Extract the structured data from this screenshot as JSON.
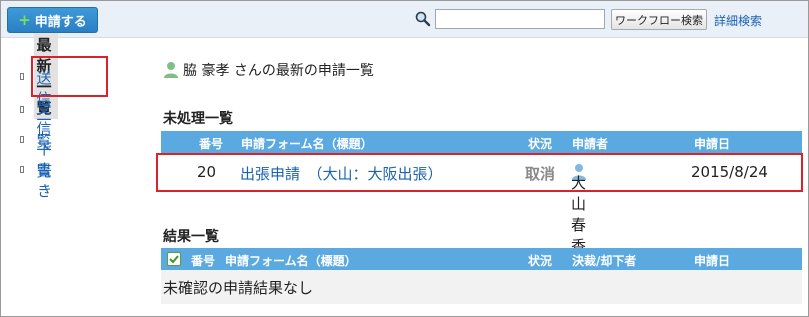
{
  "toolbar": {
    "apply_button": "申請する",
    "search_placeholder": "",
    "workflow_search_button": "ワークフロー検索",
    "detail_search_link": "詳細検索"
  },
  "sidebar": {
    "items": [
      {
        "label": "最新一覧",
        "active": true
      },
      {
        "label": "送信一覧",
        "active": false
      },
      {
        "label": "受信一覧",
        "active": false
      },
      {
        "label": "下書き",
        "active": false
      }
    ]
  },
  "main": {
    "title": "脇 豪孝 さんの最新の申請一覧",
    "pending": {
      "section_title": "未処理一覧",
      "columns": [
        "番号",
        "申請フォーム名（標題）",
        "状況",
        "申請者",
        "申請日"
      ],
      "rows": [
        {
          "number": "20",
          "form": "出張申請　（大山：大阪出張）",
          "status": "取消",
          "applicant": "大山 春香",
          "date": "2015/8/24"
        }
      ]
    },
    "results": {
      "section_title": "結果一覧",
      "columns": [
        "番号",
        "申請フォーム名（標題）",
        "状況",
        "決裁/却下者",
        "申請日"
      ],
      "empty_message": "未確認の申請結果なし"
    }
  },
  "colors": {
    "accent": "#2a7fc2",
    "table_header": "#5aa9e0",
    "link": "#1a62b3",
    "highlight": "#d8232a"
  }
}
